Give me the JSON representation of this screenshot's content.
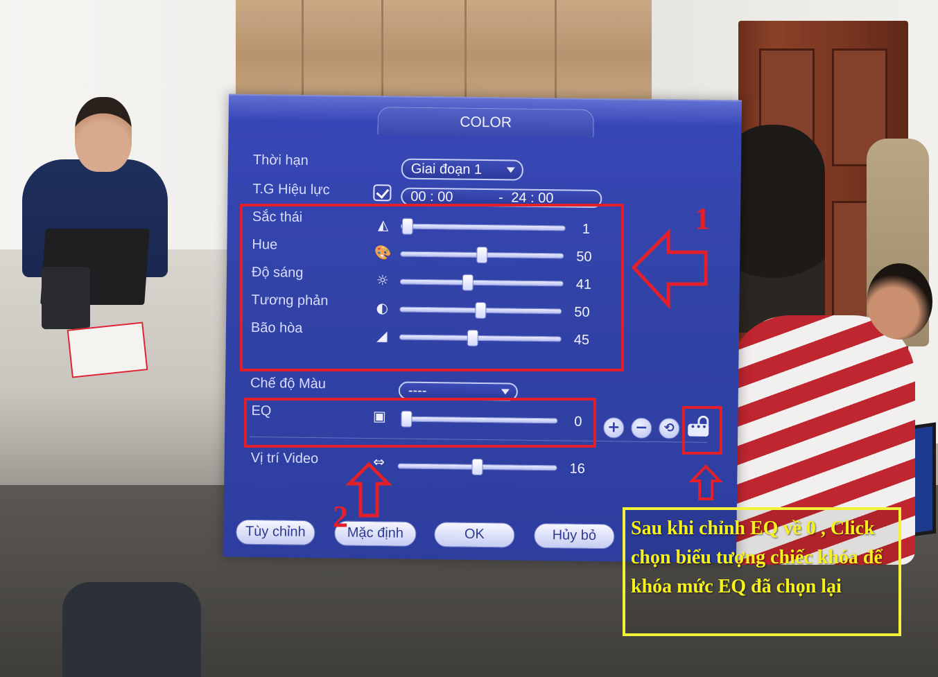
{
  "dialog": {
    "title": "COLOR",
    "period": {
      "label": "Thời hạn",
      "value": "Giai đoạn 1"
    },
    "valid_time": {
      "label": "T.G Hiệu lực",
      "checked": true,
      "start": "00 : 00",
      "end": "24 : 00"
    },
    "sliders": [
      {
        "label": "Sắc thái",
        "icon": "sharpness-icon",
        "value": 1
      },
      {
        "label": "Hue",
        "icon": "palette-icon",
        "value": 50
      },
      {
        "label": "Độ sáng",
        "icon": "brightness-icon",
        "value": 41
      },
      {
        "label": "Tương phản",
        "icon": "contrast-icon",
        "value": 50
      },
      {
        "label": "Bão hòa",
        "icon": "saturation-icon",
        "value": 45
      }
    ],
    "color_mode": {
      "label": "Chế độ Màu",
      "value": "----"
    },
    "eq": {
      "label": "EQ",
      "icon": "eq-icon",
      "value": 0
    },
    "video_position": {
      "label": "Vị trí Video",
      "icon": "position-icon",
      "value": 16
    },
    "side_buttons": {
      "plus": "+",
      "minus": "−"
    },
    "buttons": {
      "custom": "Tùy chỉnh",
      "default": "Mặc định",
      "ok": "OK",
      "cancel": "Hủy bỏ"
    }
  },
  "annotations": {
    "marker_1": "1",
    "marker_2": "2",
    "note": "Sau khi chỉnh EQ về 0 , Click chọn biểu tượng chiếc khóa để khóa mức EQ đã chọn lại",
    "box_color": "#e3202a",
    "note_color": "#f7f21b"
  },
  "colors": {
    "dialog_bg": "#3243a8",
    "label": "#d9ddff"
  }
}
